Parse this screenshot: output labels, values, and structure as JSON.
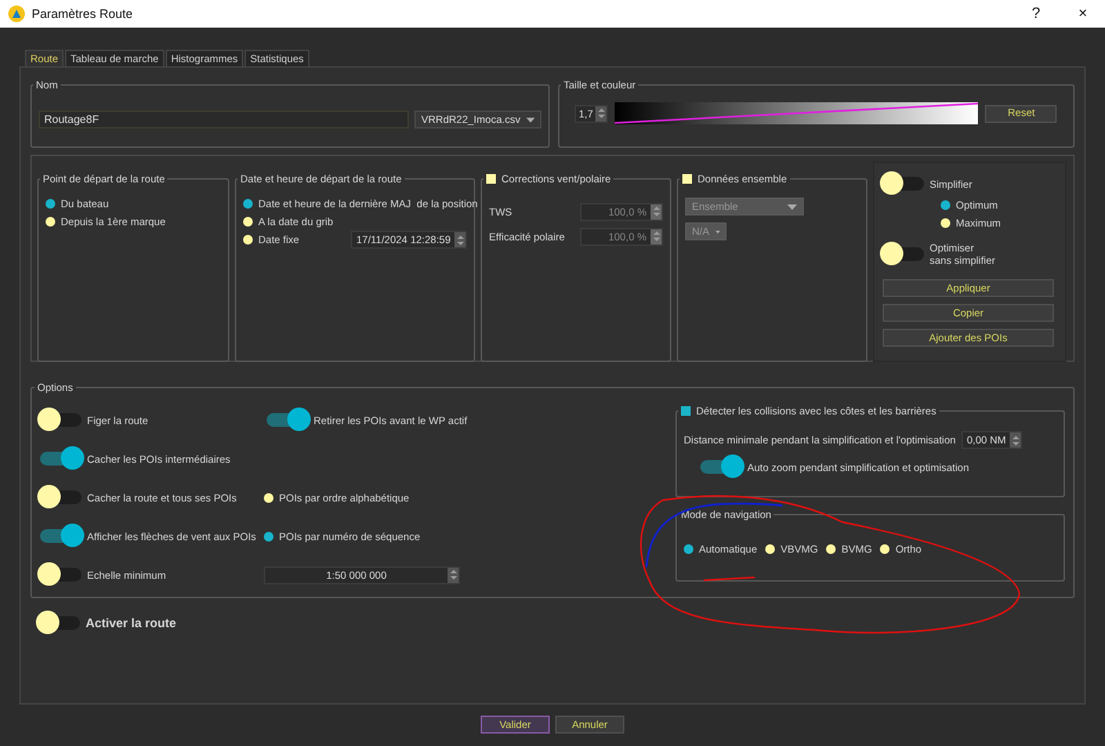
{
  "window": {
    "title": "Paramètres Route",
    "help": "?",
    "close": "×"
  },
  "tabs": [
    {
      "label": "Route",
      "selected": true
    },
    {
      "label": "Tableau de marche",
      "selected": false
    },
    {
      "label": "Histogrammes",
      "selected": false
    },
    {
      "label": "Statistiques",
      "selected": false
    }
  ],
  "name_group": {
    "title": "Nom",
    "name_value": "Routage8F",
    "polar_file": "VRRdR22_Imoca.csv"
  },
  "size_color": {
    "title": "Taille et couleur",
    "width_value": "1,7",
    "reset": "Reset"
  },
  "start_point": {
    "title": "Point de départ de la route",
    "options": [
      {
        "label": "Du bateau",
        "selected": true
      },
      {
        "label": "Depuis la 1ère marque",
        "selected": false
      }
    ]
  },
  "start_time": {
    "title": "Date et heure de départ de la route",
    "options": [
      {
        "label": "Date et heure de la dernière MAJ  de la position",
        "selected": true
      },
      {
        "label": "A la date du grib",
        "selected": false
      },
      {
        "label": "Date fixe",
        "selected": false
      }
    ],
    "fixed_date": "17/11/2024 12:28:59"
  },
  "corrections": {
    "title": "Corrections vent/polaire",
    "checked": false,
    "fields": [
      {
        "label": "TWS",
        "value": "100,0 %"
      },
      {
        "label": "Efficacité polaire",
        "value": "100,0 %"
      }
    ]
  },
  "ensemble": {
    "title": "Données ensemble",
    "checked": false,
    "dataset": "Ensemble",
    "member": "N/A"
  },
  "simplify": {
    "simplify_toggle": {
      "label": "Simplifier",
      "on": false
    },
    "modes": [
      {
        "label": "Optimum",
        "selected": true
      },
      {
        "label": "Maximum",
        "selected": false
      }
    ],
    "optimize_toggle": {
      "label": "Optimiser\nsans simplifier",
      "on": false
    },
    "buttons": [
      "Appliquer",
      "Copier",
      "Ajouter des POIs"
    ]
  },
  "options": {
    "title": "Options",
    "rows": [
      {
        "toggle": {
          "label": "Figer la route",
          "on": false
        },
        "extra": {
          "kind": "toggle",
          "label": "Retirer les POIs avant le WP actif",
          "on": true
        }
      },
      {
        "toggle": {
          "label": "Cacher les POIs intermédiaires",
          "on": true
        }
      },
      {
        "toggle": {
          "label": "Cacher la route et tous ses POIs",
          "on": false
        },
        "extra": {
          "kind": "radio",
          "label": "POIs par ordre alphabétique",
          "selected": false
        }
      },
      {
        "toggle": {
          "label": "Afficher les flèches de vent aux POIs",
          "on": true
        },
        "extra": {
          "kind": "radio",
          "label": "POIs par numéro de séquence",
          "selected": true
        }
      },
      {
        "toggle": {
          "label": "Echelle minimum",
          "on": false
        },
        "extra": {
          "kind": "spinbox",
          "value": "1:50 000 000"
        }
      }
    ],
    "collisions": {
      "title": "Détecter les collisions avec les côtes et les barrières",
      "checked": true,
      "distance_label": "Distance minimale pendant la simplification et l'optimisation",
      "distance_value": "0,00 NM",
      "auto_zoom": {
        "label": "Auto zoom pendant simplification et optimisation",
        "on": true
      }
    },
    "navigation_mode": {
      "title": "Mode de navigation",
      "options": [
        {
          "label": "Automatique",
          "selected": true
        },
        {
          "label": "VBVMG",
          "selected": false
        },
        {
          "label": "BVMG",
          "selected": false
        },
        {
          "label": "Ortho",
          "selected": false
        }
      ]
    }
  },
  "activate": {
    "label": "Activer la route",
    "on": false
  },
  "footer_buttons": [
    {
      "label": "Valider",
      "default": true
    },
    {
      "label": "Annuler",
      "default": false
    }
  ]
}
